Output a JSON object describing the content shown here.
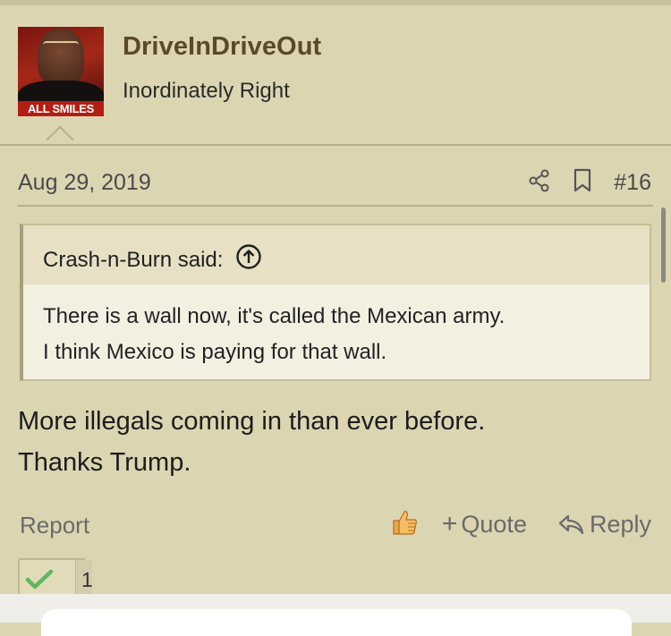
{
  "user": {
    "avatar_caption": "ALL SMILES",
    "username": "DriveInDriveOut",
    "title": "Inordinately Right"
  },
  "post": {
    "date": "Aug 29, 2019",
    "number": "#16",
    "icons": [
      "share-icon",
      "bookmark-icon"
    ]
  },
  "quote": {
    "author": "Crash-n-Burn said:",
    "lines": [
      "There is a wall now, it's called the Mexican army.",
      "I think Mexico is paying for that wall."
    ]
  },
  "message": {
    "lines": [
      "More illegals coming in than ever before.",
      "Thanks Trump."
    ]
  },
  "footer": {
    "report_label": "Report",
    "quote_label": "Quote",
    "reply_label": "Reply"
  },
  "reactions": {
    "count": "1"
  },
  "colors": {
    "background": "#dcd5b2",
    "username": "#5a4a2a",
    "quote_bg": "#f3f0e2",
    "check": "#5cb85c"
  }
}
